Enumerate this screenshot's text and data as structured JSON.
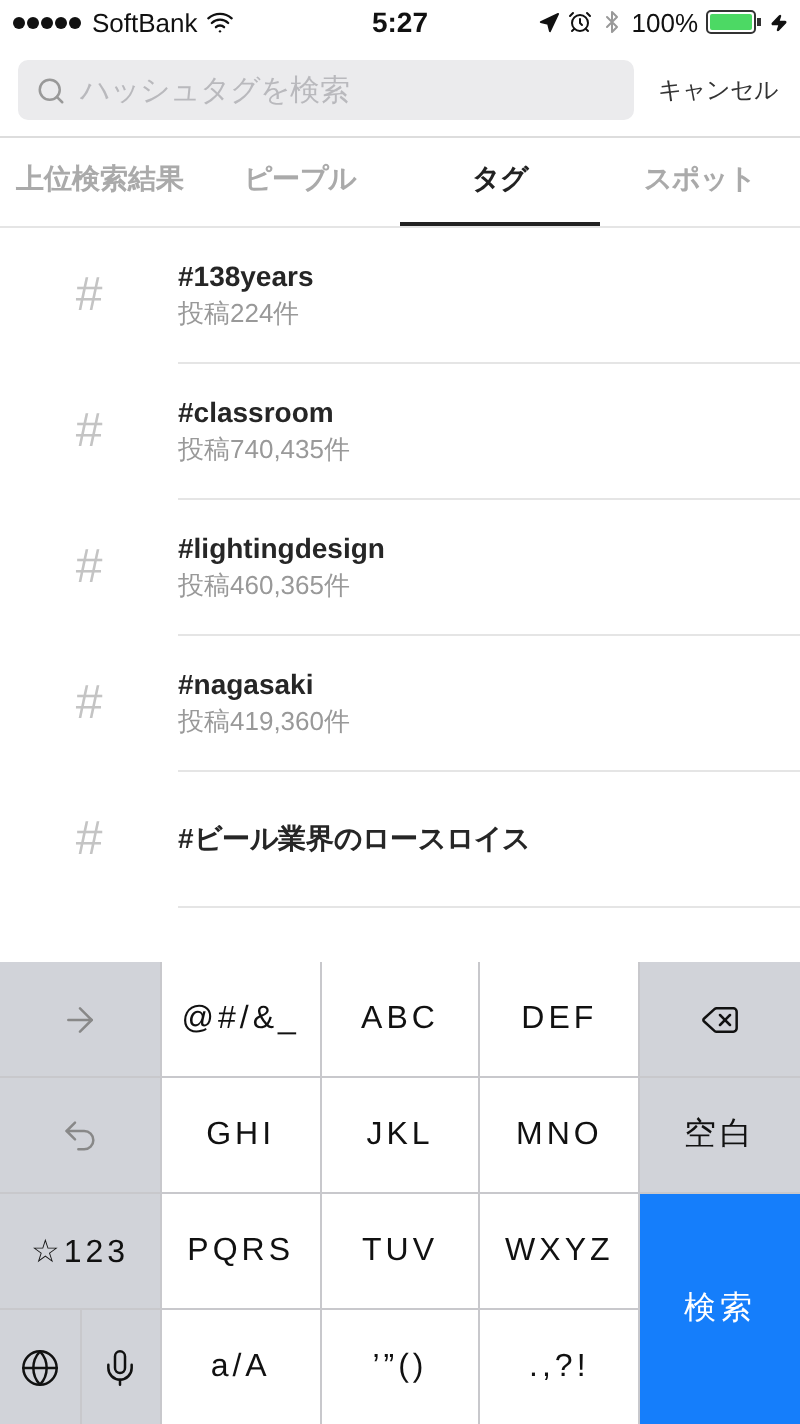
{
  "status_bar": {
    "carrier": "SoftBank",
    "time": "5:27",
    "battery": "100%"
  },
  "search": {
    "placeholder": "ハッシュタグを検索",
    "cancel": "キャンセル"
  },
  "tabs": [
    {
      "label": "上位検索結果",
      "selected": false
    },
    {
      "label": "ピープル",
      "selected": false
    },
    {
      "label": "タグ",
      "selected": true
    },
    {
      "label": "スポット",
      "selected": false
    }
  ],
  "tags": [
    {
      "icon": "#",
      "name": "#138years",
      "count": "投稿224件"
    },
    {
      "icon": "#",
      "name": "#classroom",
      "count": "投稿740,435件"
    },
    {
      "icon": "#",
      "name": "#lightingdesign",
      "count": "投稿460,365件"
    },
    {
      "icon": "#",
      "name": "#nagasaki",
      "count": "投稿419,360件"
    },
    {
      "icon": "#",
      "name": "#ビール業界のロースロイス"
    }
  ],
  "keyboard": {
    "rows": [
      [
        {
          "kind": "arrow"
        },
        {
          "kind": "letter",
          "label": "@#/&_"
        },
        {
          "kind": "letter",
          "label": "ABC"
        },
        {
          "kind": "letter",
          "label": "DEF"
        },
        {
          "kind": "delete"
        }
      ],
      [
        {
          "kind": "undo"
        },
        {
          "kind": "letter",
          "label": "GHI"
        },
        {
          "kind": "letter",
          "label": "JKL"
        },
        {
          "kind": "letter",
          "label": "MNO"
        },
        {
          "kind": "side",
          "label": "空白"
        }
      ],
      [
        {
          "kind": "side",
          "label": "☆123"
        },
        {
          "kind": "letter",
          "label": "PQRS"
        },
        {
          "kind": "letter",
          "label": "TUV"
        },
        {
          "kind": "letter",
          "label": "WXYZ"
        },
        {
          "kind": "action",
          "label": "検索"
        }
      ],
      [
        {
          "kind": "pair",
          "keys": [
            {
              "kind": "globe"
            },
            {
              "kind": "mic"
            }
          ]
        },
        {
          "kind": "letter",
          "label": "a/A"
        },
        {
          "kind": "letter",
          "label": "’”()"
        },
        {
          "kind": "letter",
          "label": ".,?!"
        }
      ]
    ]
  }
}
